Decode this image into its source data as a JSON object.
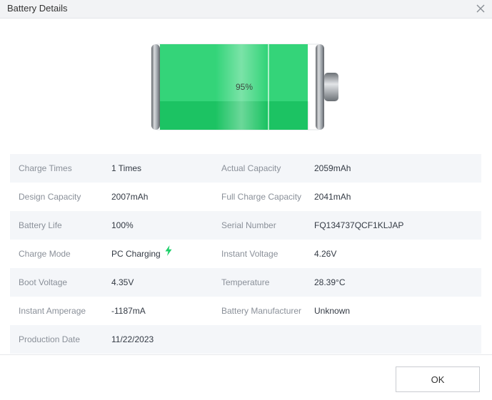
{
  "window": {
    "title": "Battery Details"
  },
  "battery": {
    "percent_label": "95%",
    "level": 0.95,
    "fill_color": "#1ed06a"
  },
  "details": [
    {
      "label1": "Charge Times",
      "value1": "1 Times",
      "label2": "Actual Capacity",
      "value2": "2059mAh"
    },
    {
      "label1": "Design Capacity",
      "value1": "2007mAh",
      "label2": "Full Charge Capacity",
      "value2": "2041mAh"
    },
    {
      "label1": "Battery Life",
      "value1": "100%",
      "label2": "Serial Number",
      "value2": "FQ134737QCF1KLJAP"
    },
    {
      "label1": "Charge Mode",
      "value1": "PC Charging",
      "label2": "Instant Voltage",
      "value2": "4.26V"
    },
    {
      "label1": "Boot Voltage",
      "value1": "4.35V",
      "label2": "Temperature",
      "value2": "28.39°C"
    },
    {
      "label1": "Instant Amperage",
      "value1": "-1187mA",
      "label2": "Battery Manufacturer",
      "value2": "Unknown"
    },
    {
      "label1": "Production Date",
      "value1": "11/22/2023",
      "label2": "",
      "value2": ""
    }
  ],
  "icons": {
    "close": "close-icon",
    "charging": "lightning-bolt-icon"
  },
  "colors": {
    "accent_green": "#1ed06a",
    "row_shade": "#f4f6f9"
  },
  "footer": {
    "ok_label": "OK"
  }
}
